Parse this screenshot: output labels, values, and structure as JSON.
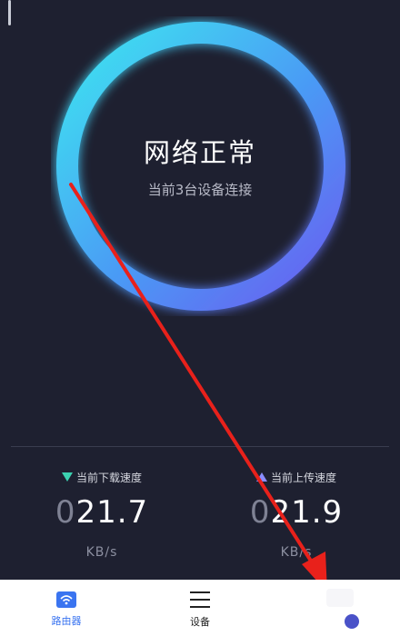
{
  "status": {
    "title": "网络正常",
    "subtitle": "当前3台设备连接"
  },
  "colors": {
    "background": "#1e2030",
    "ring_start": "#3ee6f0",
    "ring_end": "#6b5cf0",
    "annotation_arrow": "#e8211b",
    "nav_active": "#3a74f0"
  },
  "metrics": {
    "download": {
      "label": "当前下载速度",
      "lead": "0",
      "value": "21.7",
      "unit": "KB/s",
      "icon": "triangle-down-icon"
    },
    "upload": {
      "label": "当前上传速度",
      "lead": "0",
      "value": "21.9",
      "unit": "KB/s",
      "icon": "triangle-up-icon"
    }
  },
  "nav": {
    "items": [
      {
        "label": "路由器",
        "icon": "router-wifi-icon",
        "active": true
      },
      {
        "label": "设备",
        "icon": "menu-icon",
        "active": false
      },
      {
        "label": "",
        "icon": "me-icon",
        "active": false
      }
    ]
  }
}
